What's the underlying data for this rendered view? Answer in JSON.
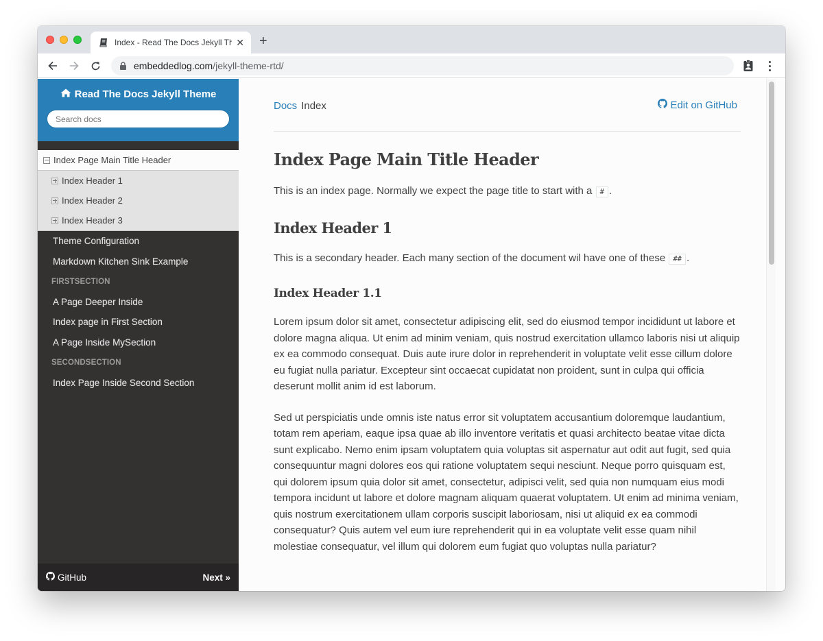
{
  "browser": {
    "tab_title": "Index - Read The Docs Jekyll Theme",
    "new_tab_label": "+",
    "url_host": "embeddedlog.com",
    "url_path": "/jekyll-theme-rtd/",
    "colors": {
      "tabstrip": "#dee1e6",
      "close": "#ff5f57",
      "minimize": "#febc2e",
      "maximize": "#28c840"
    }
  },
  "sidebar": {
    "brand": "Read The Docs Jekyll Theme",
    "search_placeholder": "Search docs",
    "current_page": "Index Page Main Title Header",
    "current_subitems": [
      {
        "label": "Index Header 1"
      },
      {
        "label": "Index Header 2"
      },
      {
        "label": "Index Header 3"
      }
    ],
    "items": [
      {
        "label": "Theme Configuration"
      },
      {
        "label": "Markdown Kitchen Sink Example"
      }
    ],
    "sections": [
      {
        "caption": "FIRSTSECTION",
        "items": [
          {
            "label": "A Page Deeper Inside"
          },
          {
            "label": "Index page in First Section"
          },
          {
            "label": "A Page Inside MySection"
          }
        ]
      },
      {
        "caption": "SECONDSECTION",
        "items": [
          {
            "label": "Index Page Inside Second Section"
          }
        ]
      }
    ],
    "footer": {
      "github_label": "GitHub",
      "next_label": "Next »"
    },
    "colors": {
      "brand_bg": "#2980b9",
      "nav_bg": "#343131",
      "footer_bg": "#272525"
    }
  },
  "content": {
    "breadcrumbs": [
      {
        "label": "Docs"
      },
      {
        "label": "Index"
      }
    ],
    "edit_link": "Edit on GitHub",
    "title": "Index Page Main Title Header",
    "intro_text": "This is an index page. Normally we expect the page title to start with a",
    "intro_code": "#",
    "intro_end": ".",
    "h2": "Index Header 1",
    "h2_text": "This is a secondary header. Each many section of the document wil have one of these",
    "h2_code": "##",
    "h2_end": ".",
    "h3": "Index Header 1.1",
    "paragraphs": [
      "Lorem ipsum dolor sit amet, consectetur adipiscing elit, sed do eiusmod tempor incididunt ut labore et dolore magna aliqua. Ut enim ad minim veniam, quis nostrud exercitation ullamco laboris nisi ut aliquip ex ea commodo consequat. Duis aute irure dolor in reprehenderit in voluptate velit esse cillum dolore eu fugiat nulla pariatur. Excepteur sint occaecat cupidatat non proident, sunt in culpa qui officia deserunt mollit anim id est laborum.",
      "Sed ut perspiciatis unde omnis iste natus error sit voluptatem accusantium doloremque laudantium, totam rem aperiam, eaque ipsa quae ab illo inventore veritatis et quasi architecto beatae vitae dicta sunt explicabo. Nemo enim ipsam voluptatem quia voluptas sit aspernatur aut odit aut fugit, sed quia consequuntur magni dolores eos qui ratione voluptatem sequi nesciunt. Neque porro quisquam est, qui dolorem ipsum quia dolor sit amet, consectetur, adipisci velit, sed quia non numquam eius modi tempora incidunt ut labore et dolore magnam aliquam quaerat voluptatem. Ut enim ad minima veniam, quis nostrum exercitationem ullam corporis suscipit laboriosam, nisi ut aliquid ex ea commodi consequatur? Quis autem vel eum iure reprehenderit qui in ea voluptate velit esse quam nihil molestiae consequatur, vel illum qui dolorem eum fugiat quo voluptas nulla pariatur?"
    ],
    "colors": {
      "link": "#2980b9",
      "text": "#404040",
      "background": "#fcfcfc"
    }
  },
  "icons": {
    "tab_favicon": "book-icon",
    "close_tab": "close-icon",
    "back": "arrow-left-icon",
    "forward": "arrow-right-icon",
    "reload": "reload-icon",
    "lock": "lock-icon",
    "extension": "badge-icon",
    "menu": "kebab-menu-icon",
    "home": "home-icon",
    "github": "github-icon",
    "toggle_expanded": "minus-square-icon",
    "toggle_collapsed": "plus-square-icon"
  }
}
